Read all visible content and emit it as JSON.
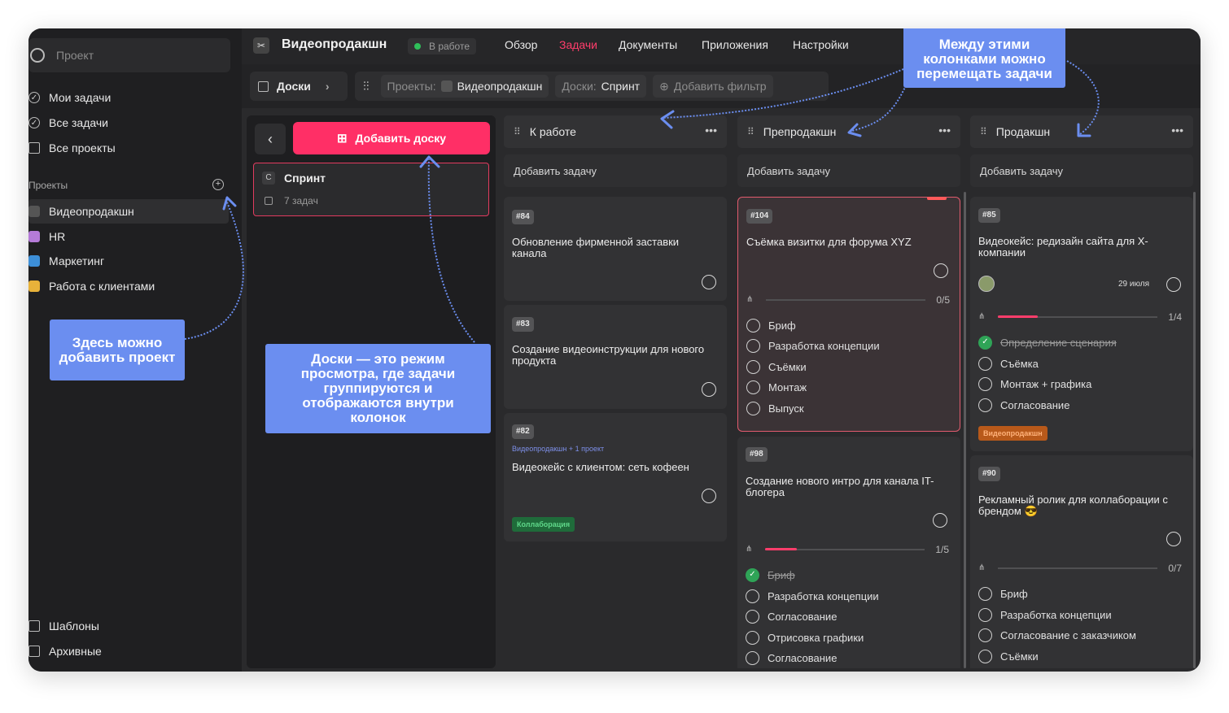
{
  "sidebar": {
    "search_placeholder": "Проект",
    "nav": [
      "Мои задачи",
      "Все задачи",
      "Все проекты"
    ],
    "section_title": "Проекты",
    "projects": [
      "Видеопродакшн",
      "HR",
      "Маркетинг",
      "Работа с клиентами"
    ],
    "footer": [
      "Шаблоны",
      "Архивные"
    ]
  },
  "topbar": {
    "project_title": "Видеопродакшн",
    "status": "В работе",
    "tabs": [
      "Обзор",
      "Задачи",
      "Документы",
      "Приложения",
      "Настройки"
    ],
    "active_tab": "Задачи"
  },
  "filterbar": {
    "view_label": "Доски",
    "projects_label": "Проекты:",
    "projects_value": "Видеопродакшн",
    "boards_label": "Доски:",
    "boards_value": "Спринт",
    "add_filter": "Добавить фильтр"
  },
  "boards_panel": {
    "add_board": "Добавить доску",
    "board": {
      "letter": "С",
      "name": "Спринт",
      "count": "7 задач"
    }
  },
  "columns": [
    {
      "title": "К работе",
      "add_task": "Добавить задачу",
      "cards": [
        {
          "tag": "#84",
          "title": "Обновление фирменной заставки канала"
        },
        {
          "tag": "#83",
          "title": "Создание видеоинструкции для нового продукта"
        },
        {
          "tag": "#82",
          "project_line": "Видеопродакшн + 1 проект",
          "title": "Видеокейс с клиентом: сеть кофеен",
          "label": "Коллаборация"
        }
      ]
    },
    {
      "title": "Препродакшн",
      "add_task": "Добавить задачу",
      "cards": [
        {
          "tag": "#104",
          "title": "Съёмка визитки для форума XYZ",
          "progress": "0/5",
          "progress_fraction": 0,
          "subtasks": [
            "Бриф",
            "Разработка концепции",
            "Съёмки",
            "Монтаж",
            "Выпуск"
          ]
        },
        {
          "tag": "#98",
          "title": "Создание нового интро для канала IT-блогера",
          "progress": "1/5",
          "progress_fraction": 0.2,
          "subtasks": [
            "Бриф",
            "Разработка концепции",
            "Согласование",
            "Отрисовка графики",
            "Согласование"
          ]
        }
      ]
    },
    {
      "title": "Продакшн",
      "add_task": "Добавить задачу",
      "cards": [
        {
          "tag": "#85",
          "title": "Видеокейс: редизайн сайта для X-компании",
          "date": "29 июля",
          "progress": "1/4",
          "progress_fraction": 0.25,
          "subtasks": [
            "Определение сценария",
            "Съёмка",
            "Монтаж + графика",
            "Согласование"
          ],
          "label": "Видеопродакшн"
        },
        {
          "tag": "#90",
          "title": "Рекламный ролик для коллаборации с брендом",
          "emoji": "😎",
          "progress": "0/7",
          "progress_fraction": 0,
          "subtasks": [
            "Бриф",
            "Разработка концепции",
            "Согласование с заказчиком",
            "Съёмки"
          ]
        }
      ]
    }
  ],
  "callouts": {
    "add_project": "Здесь можно добавить проект",
    "boards_info": "Доски — это режим просмотра, где задачи группируются и отображаются внутри колонок",
    "move_tasks": "Между этими колонками можно перемещать задачи"
  },
  "colors": {
    "accent": "#ff2f66",
    "callout": "#6b8ef0",
    "done": "#2fa457"
  }
}
